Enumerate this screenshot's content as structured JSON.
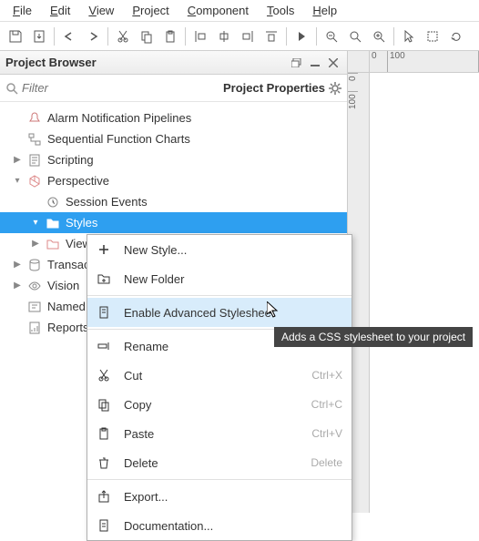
{
  "menubar": [
    "File",
    "Edit",
    "View",
    "Project",
    "Component",
    "Tools",
    "Help"
  ],
  "toolbar_icons": [
    "save",
    "import",
    "undo",
    "redo",
    "cut",
    "copy",
    "paste",
    "align-left",
    "align-center",
    "align-right",
    "align-top",
    "play",
    "zoom-out",
    "zoom-reset",
    "zoom-in",
    "pointer",
    "marquee",
    "rotate"
  ],
  "panel": {
    "title": "Project Browser",
    "filter_placeholder": "Filter",
    "project_props": "Project Properties"
  },
  "ruler": {
    "h": [
      "0",
      "100"
    ],
    "v": [
      "0",
      "100"
    ]
  },
  "tree": [
    {
      "label": "Alarm Notification Pipelines",
      "icon": "bell",
      "indent": "root",
      "toggle": ""
    },
    {
      "label": "Sequential Function Charts",
      "icon": "flow",
      "indent": "root",
      "toggle": ""
    },
    {
      "label": "Scripting",
      "icon": "script",
      "indent": "root",
      "toggle": "▶"
    },
    {
      "label": "Perspective",
      "icon": "cube",
      "indent": "root",
      "toggle": "▾"
    },
    {
      "label": "Session Events",
      "icon": "event",
      "indent": "child",
      "toggle": ""
    },
    {
      "label": "Styles",
      "icon": "folder",
      "indent": "child",
      "toggle": "▾",
      "selected": true
    },
    {
      "label": "Views",
      "icon": "folder-o",
      "indent": "child",
      "toggle": "▶"
    },
    {
      "label": "Transact",
      "icon": "db",
      "indent": "root",
      "toggle": "▶",
      "clip": true
    },
    {
      "label": "Vision",
      "icon": "eye",
      "indent": "root",
      "toggle": "▶"
    },
    {
      "label": "Named C",
      "icon": "query",
      "indent": "root",
      "toggle": "",
      "clip": true
    },
    {
      "label": "Reports",
      "icon": "report",
      "indent": "root",
      "toggle": ""
    }
  ],
  "context_menu": [
    {
      "type": "item",
      "label": "New Style...",
      "icon": "plus",
      "enabled": true
    },
    {
      "type": "item",
      "label": "New Folder",
      "icon": "folder-plus",
      "enabled": true
    },
    {
      "type": "sep"
    },
    {
      "type": "item",
      "label": "Enable Advanced Stylesheet",
      "icon": "doc",
      "enabled": true,
      "hover": true
    },
    {
      "type": "sep"
    },
    {
      "type": "item",
      "label": "Rename",
      "icon": "rename",
      "enabled": false
    },
    {
      "type": "item",
      "label": "Cut",
      "icon": "cut",
      "shortcut": "Ctrl+X",
      "enabled": false
    },
    {
      "type": "item",
      "label": "Copy",
      "icon": "copy",
      "shortcut": "Ctrl+C",
      "enabled": false
    },
    {
      "type": "item",
      "label": "Paste",
      "icon": "paste",
      "shortcut": "Ctrl+V",
      "enabled": false
    },
    {
      "type": "item",
      "label": "Delete",
      "icon": "trash",
      "shortcut": "Delete",
      "enabled": false
    },
    {
      "type": "sep"
    },
    {
      "type": "item",
      "label": "Export...",
      "icon": "export",
      "enabled": true
    },
    {
      "type": "item",
      "label": "Documentation...",
      "icon": "doc2",
      "enabled": false
    }
  ],
  "tooltip": "Adds a CSS stylesheet to your project"
}
